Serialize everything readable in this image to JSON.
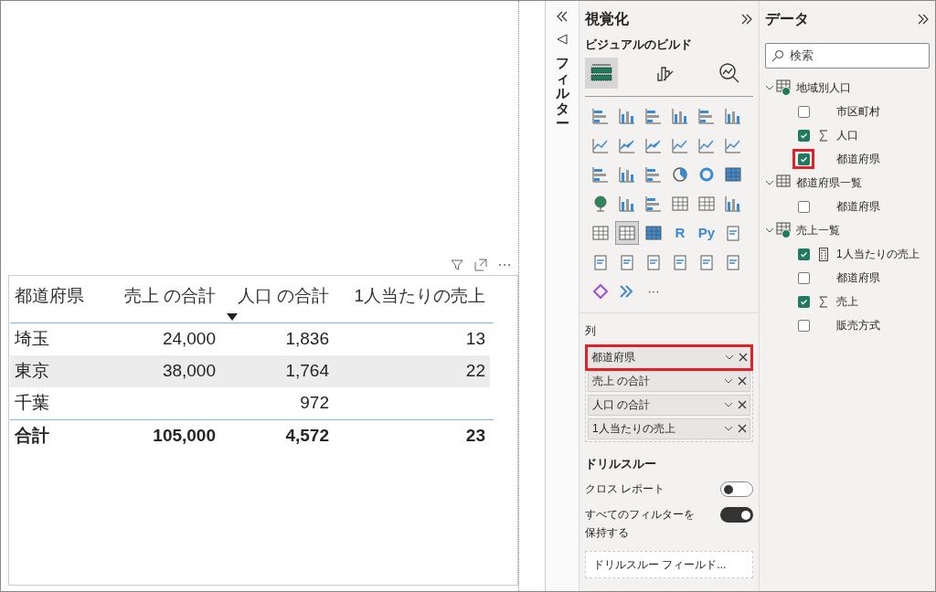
{
  "table": {
    "columns": [
      {
        "label": "都道府県",
        "sorted": false
      },
      {
        "label": "売上 の合計",
        "sorted": false
      },
      {
        "label": "人口 の合計",
        "sorted": true
      },
      {
        "label": "1人当たりの売上",
        "sorted": false
      }
    ],
    "rows": [
      {
        "cells": [
          "埼玉",
          "24,000",
          "1,836",
          "13"
        ],
        "selected": false
      },
      {
        "cells": [
          "東京",
          "38,000",
          "1,764",
          "22"
        ],
        "selected": true
      },
      {
        "cells": [
          "千葉",
          "",
          "972",
          ""
        ],
        "selected": false
      }
    ],
    "total": [
      "合計",
      "105,000",
      "4,572",
      "23"
    ]
  },
  "filters_pane": {
    "title": "フィルター"
  },
  "visualizations": {
    "title": "視覚化",
    "subtitle": "ビジュアルのビルド",
    "build_tabs": [
      {
        "selected": true
      },
      {
        "selected": false
      },
      {
        "selected": false
      }
    ],
    "visual_types": [
      {
        "selected": false
      },
      {
        "selected": false
      },
      {
        "selected": false
      },
      {
        "selected": false
      },
      {
        "selected": false
      },
      {
        "selected": false
      },
      {
        "selected": false
      },
      {
        "selected": false
      },
      {
        "selected": false
      },
      {
        "selected": false
      },
      {
        "selected": false
      },
      {
        "selected": false
      },
      {
        "selected": false
      },
      {
        "selected": false
      },
      {
        "selected": false
      },
      {
        "selected": false
      },
      {
        "selected": false
      },
      {
        "selected": false
      },
      {
        "selected": false
      },
      {
        "selected": false
      },
      {
        "selected": false
      },
      {
        "selected": false
      },
      {
        "selected": false
      },
      {
        "selected": false
      },
      {
        "selected": false
      },
      {
        "selected": true
      },
      {
        "selected": false
      },
      {
        "selected": false,
        "glyph": "R"
      },
      {
        "selected": false,
        "glyph": "Py"
      },
      {
        "selected": false
      },
      {
        "selected": false
      },
      {
        "selected": false
      },
      {
        "selected": false
      },
      {
        "selected": false
      },
      {
        "selected": false
      },
      {
        "selected": false
      },
      {
        "selected": false
      },
      {
        "selected": false
      }
    ],
    "more": "···",
    "well_label": "列",
    "fields": [
      {
        "label": "都道府県",
        "highlighted": true
      },
      {
        "label": "売上 の合計",
        "highlighted": false
      },
      {
        "label": "人口 の合計",
        "highlighted": false
      },
      {
        "label": "1人当たりの売上",
        "highlighted": false
      }
    ],
    "drillthrough": {
      "title": "ドリルスルー",
      "options": [
        {
          "label": "クロス レポート",
          "on": false
        },
        {
          "label": "すべてのフィルターを保持する",
          "on": true
        }
      ],
      "field_placeholder": "ドリルスルー フィールド..."
    }
  },
  "data": {
    "title": "データ",
    "search": {
      "placeholder": "検索"
    },
    "tables": [
      {
        "name": "地域別人口",
        "used": true,
        "expanded": true,
        "fields": [
          {
            "name": "市区町村",
            "checked": false,
            "kind": "text",
            "highlighted": false
          },
          {
            "name": "人口",
            "checked": true,
            "kind": "sum",
            "highlighted": false
          },
          {
            "name": "都道府県",
            "checked": true,
            "kind": "text",
            "highlighted": true
          }
        ]
      },
      {
        "name": "都道府県一覧",
        "used": false,
        "expanded": true,
        "fields": [
          {
            "name": "都道府県",
            "checked": false,
            "kind": "text",
            "highlighted": false
          }
        ]
      },
      {
        "name": "売上一覧",
        "used": true,
        "expanded": true,
        "fields": [
          {
            "name": "1人当たりの売上",
            "checked": true,
            "kind": "measure",
            "highlighted": false
          },
          {
            "name": "都道府県",
            "checked": false,
            "kind": "text",
            "highlighted": false
          },
          {
            "name": "売上",
            "checked": true,
            "kind": "sum",
            "highlighted": false
          },
          {
            "name": "販売方式",
            "checked": false,
            "kind": "text",
            "highlighted": false
          }
        ]
      }
    ]
  }
}
